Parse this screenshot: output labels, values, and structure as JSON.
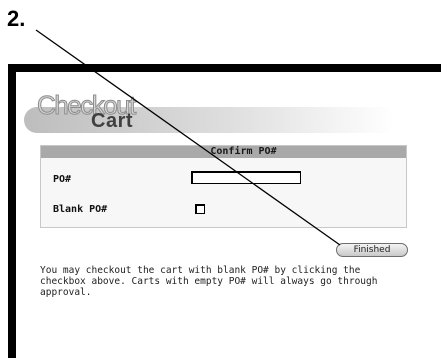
{
  "step": {
    "number": "2."
  },
  "logo": {
    "word1": "Checkout",
    "word2": "Cart"
  },
  "panel": {
    "title": "Confirm PO#",
    "po_label": "PO#",
    "po_value": "",
    "blank_label": "Blank PO#",
    "blank_checked": false
  },
  "buttons": {
    "finished": "Finished"
  },
  "info": {
    "text": "You may checkout the cart with blank PO# by clicking the checkbox above. Carts with empty PO# will always go through approval."
  },
  "colors": {
    "frame": "#000000",
    "header_bar": "#a9a9a9",
    "panel_bg": "#f7f7f7"
  },
  "icons": {
    "checkbox": "checkbox-empty",
    "pointer": "callout-line"
  }
}
